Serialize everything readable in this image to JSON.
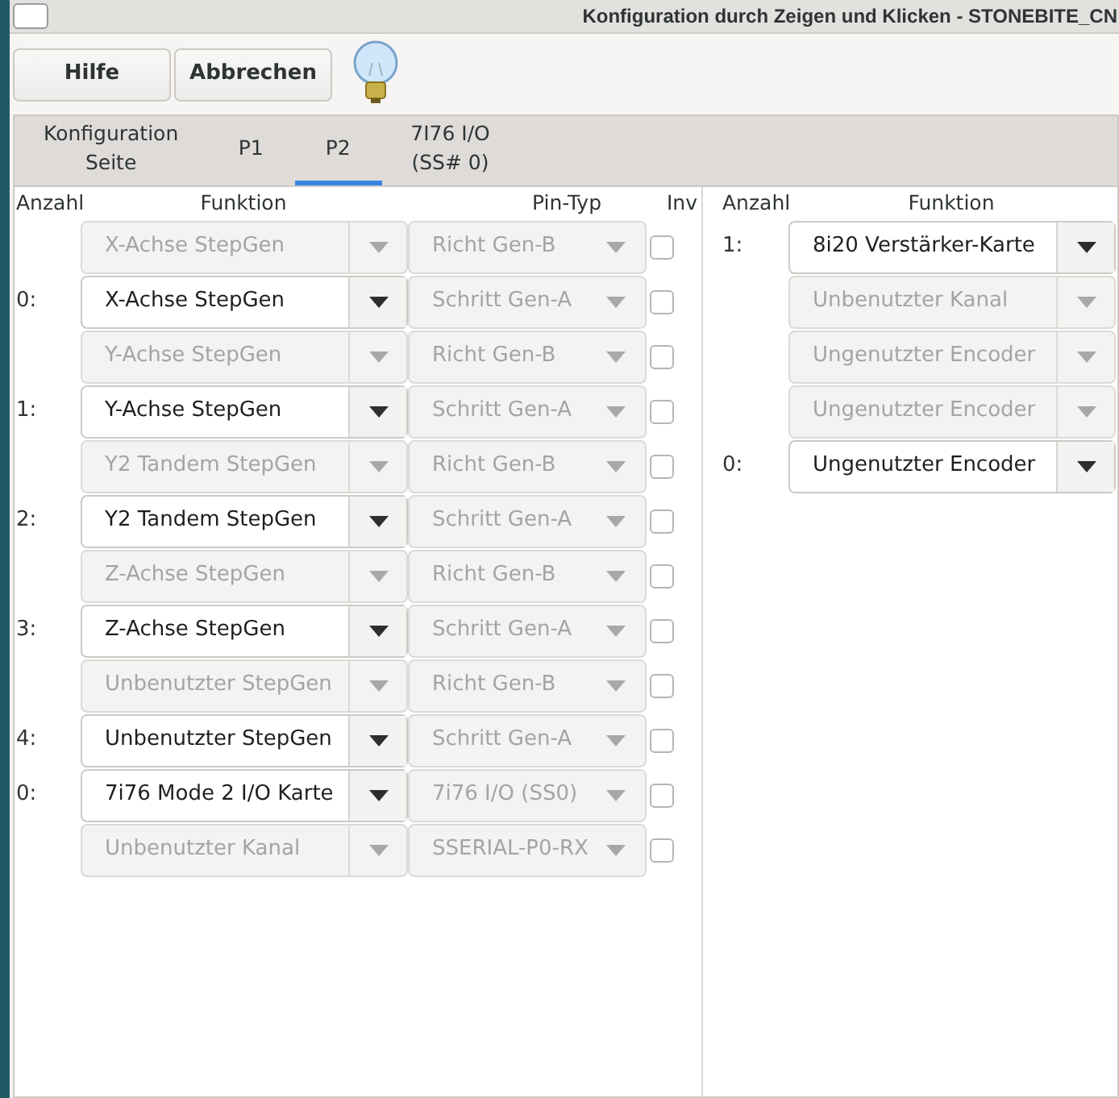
{
  "window": {
    "title": "Konfiguration durch Zeigen und Klicken - STONEBITE_CN"
  },
  "toolbar": {
    "buttons": [
      "Hilfe",
      "Abbrechen"
    ]
  },
  "tabs": [
    {
      "label": "Konfiguration\nSeite",
      "selected": false
    },
    {
      "label": "P1",
      "selected": false
    },
    {
      "label": "P2",
      "selected": true
    },
    {
      "label": "7I76 I/O\n(SS# 0)",
      "selected": false
    }
  ],
  "left_table": {
    "columns": [
      "Anzahl",
      "Funktion",
      "Pin-Typ",
      "Inv"
    ],
    "rows": [
      {
        "number": "",
        "function": {
          "value": "X-Achse StepGen",
          "disabled": true
        },
        "pin_type": {
          "value": "Richt Gen-B",
          "disabled": true
        },
        "inv": {
          "checked": false
        }
      },
      {
        "number": "0:",
        "function": {
          "value": "X-Achse StepGen",
          "disabled": false
        },
        "pin_type": {
          "value": "Schritt Gen-A",
          "disabled": true
        },
        "inv": {
          "checked": false
        }
      },
      {
        "number": "",
        "function": {
          "value": "Y-Achse StepGen",
          "disabled": true
        },
        "pin_type": {
          "value": "Richt Gen-B",
          "disabled": true
        },
        "inv": {
          "checked": false
        }
      },
      {
        "number": "1:",
        "function": {
          "value": "Y-Achse StepGen",
          "disabled": false
        },
        "pin_type": {
          "value": "Schritt Gen-A",
          "disabled": true
        },
        "inv": {
          "checked": false
        }
      },
      {
        "number": "",
        "function": {
          "value": "Y2 Tandem StepGen",
          "disabled": true
        },
        "pin_type": {
          "value": "Richt Gen-B",
          "disabled": true
        },
        "inv": {
          "checked": false
        }
      },
      {
        "number": "2:",
        "function": {
          "value": "Y2 Tandem StepGen",
          "disabled": false
        },
        "pin_type": {
          "value": "Schritt Gen-A",
          "disabled": true
        },
        "inv": {
          "checked": false
        }
      },
      {
        "number": "",
        "function": {
          "value": "Z-Achse StepGen",
          "disabled": true
        },
        "pin_type": {
          "value": "Richt Gen-B",
          "disabled": true
        },
        "inv": {
          "checked": false
        }
      },
      {
        "number": "3:",
        "function": {
          "value": "Z-Achse StepGen",
          "disabled": false
        },
        "pin_type": {
          "value": "Schritt Gen-A",
          "disabled": true
        },
        "inv": {
          "checked": false
        }
      },
      {
        "number": "",
        "function": {
          "value": "Unbenutzter StepGen",
          "disabled": true
        },
        "pin_type": {
          "value": "Richt Gen-B",
          "disabled": true
        },
        "inv": {
          "checked": false
        }
      },
      {
        "number": "4:",
        "function": {
          "value": "Unbenutzter StepGen",
          "disabled": false
        },
        "pin_type": {
          "value": "Schritt Gen-A",
          "disabled": true
        },
        "inv": {
          "checked": false
        }
      },
      {
        "number": "0:",
        "function": {
          "value": "7i76 Mode 2 I/O Karte",
          "disabled": false
        },
        "pin_type": {
          "value": "7i76 I/O (SS0)",
          "disabled": true
        },
        "inv": {
          "checked": false
        }
      },
      {
        "number": "",
        "function": {
          "value": "Unbenutzter Kanal",
          "disabled": true
        },
        "pin_type": {
          "value": "SSERIAL-P0-RX",
          "disabled": true
        },
        "inv": {
          "checked": false
        }
      }
    ]
  },
  "right_table": {
    "columns": [
      "Anzahl",
      "Funktion"
    ],
    "rows": [
      {
        "number": "1:",
        "function": {
          "value": "8i20 Verstärker-Karte",
          "disabled": false
        }
      },
      {
        "number": "",
        "function": {
          "value": "Unbenutzter Kanal",
          "disabled": true
        }
      },
      {
        "number": "",
        "function": {
          "value": "Ungenutzter Encoder",
          "disabled": true
        }
      },
      {
        "number": "",
        "function": {
          "value": "Ungenutzter Encoder",
          "disabled": true
        }
      },
      {
        "number": "0:",
        "function": {
          "value": "Ungenutzter Encoder",
          "disabled": false
        }
      }
    ]
  }
}
